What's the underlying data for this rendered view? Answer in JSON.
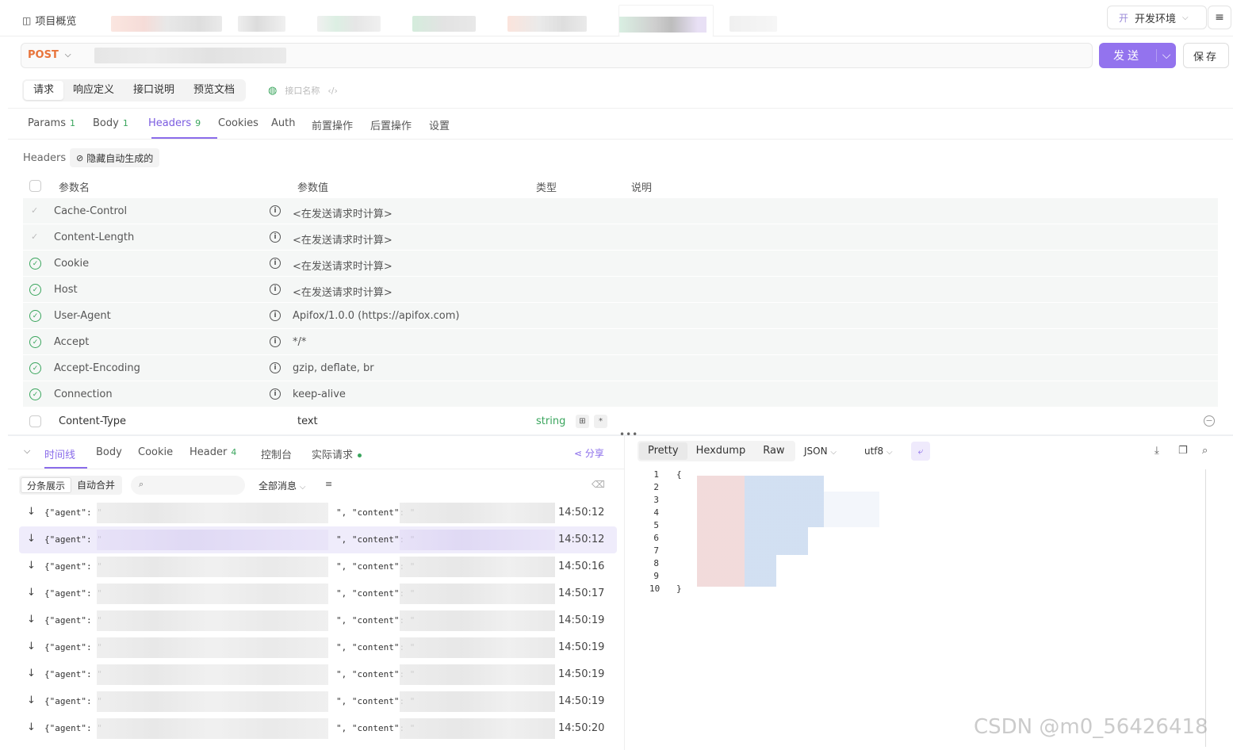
{
  "topbar": {
    "overview_label": "项目概览",
    "env_badge": "开",
    "env_label": "开发环境"
  },
  "request": {
    "method": "POST",
    "send_label": "发送",
    "save_label": "保存"
  },
  "seg_tabs": [
    "请求",
    "响应定义",
    "接口说明",
    "预览文档"
  ],
  "api_name_placeholder": "接口名称",
  "req_tabs": [
    {
      "label": "Params",
      "count": "1"
    },
    {
      "label": "Body",
      "count": "1"
    },
    {
      "label": "Headers",
      "count": "9"
    },
    {
      "label": "Cookies",
      "count": ""
    },
    {
      "label": "Auth",
      "count": ""
    },
    {
      "label": "前置操作",
      "count": ""
    },
    {
      "label": "后置操作",
      "count": ""
    },
    {
      "label": "设置",
      "count": ""
    }
  ],
  "headers_section": {
    "label": "Headers",
    "hide_auto_label": "隐藏自动生成的",
    "columns": [
      "参数名",
      "参数值",
      "类型",
      "说明"
    ],
    "auto_rows": [
      {
        "name": "Cache-Control",
        "value": "<在发送请求时计算>",
        "enabled": false
      },
      {
        "name": "Content-Length",
        "value": "<在发送请求时计算>",
        "enabled": false
      },
      {
        "name": "Cookie",
        "value": "<在发送请求时计算>",
        "enabled": true
      },
      {
        "name": "Host",
        "value": "<在发送请求时计算>",
        "enabled": true
      },
      {
        "name": "User-Agent",
        "value": "Apifox/1.0.0 (https://apifox.com)",
        "enabled": true
      },
      {
        "name": "Accept",
        "value": "*/*",
        "enabled": true
      },
      {
        "name": "Accept-Encoding",
        "value": "gzip, deflate, br",
        "enabled": true
      },
      {
        "name": "Connection",
        "value": "keep-alive",
        "enabled": true
      }
    ],
    "custom_row": {
      "name": "Content-Type",
      "value": "text",
      "type": "string",
      "required_mark": "*"
    }
  },
  "response": {
    "tabs": [
      {
        "label": "时间线",
        "count": ""
      },
      {
        "label": "Body",
        "count": ""
      },
      {
        "label": "Cookie",
        "count": ""
      },
      {
        "label": "Header",
        "count": "4"
      },
      {
        "label": "控制台",
        "count": ""
      },
      {
        "label": "实际请求",
        "count": ""
      }
    ],
    "share_label": "分享",
    "view_modes": [
      "分条展示",
      "自动合并"
    ],
    "all_messages_label": "全部消息",
    "messages": [
      {
        "prefix": "{\"agent\": \"",
        "mid": "\", \"content\": \"",
        "time": "14:50:12"
      },
      {
        "prefix": "{\"agent\": \"",
        "mid": "\", \"content\": \"",
        "time": "14:50:12"
      },
      {
        "prefix": "{\"agent\": \"",
        "mid": "\", \"content\": \"",
        "time": "14:50:16"
      },
      {
        "prefix": "{\"agent\": \"",
        "mid": "\", \"content\": \"",
        "time": "14:50:17"
      },
      {
        "prefix": "{\"agent\": \"",
        "mid": "\", \"content\": \"",
        "time": "14:50:19"
      },
      {
        "prefix": "{\"agent\": \"",
        "mid": "\", \"content\": \"",
        "time": "14:50:19"
      },
      {
        "prefix": "{\"agent\": \"",
        "mid": "\", \"content\": \"",
        "time": "14:50:19"
      },
      {
        "prefix": "{\"agent\": \"",
        "mid": "\", \"content\": \"",
        "time": "14:50:19"
      },
      {
        "prefix": "{\"agent\": \"",
        "mid": "\", \"content\": \"",
        "time": "14:50:20"
      }
    ],
    "format_tabs": [
      "Pretty",
      "Hexdump",
      "Raw"
    ],
    "format_select": "JSON",
    "encoding_select": "utf8",
    "line_numbers": [
      "1",
      "2",
      "3",
      "4",
      "5",
      "6",
      "7",
      "8",
      "9",
      "10"
    ],
    "open_brace": "{",
    "close_brace": "}"
  },
  "watermark": "CSDN @m0_56426418",
  "colors": {
    "accent": "#9373ee",
    "method": "#e8743b",
    "success": "#3aa55d"
  }
}
